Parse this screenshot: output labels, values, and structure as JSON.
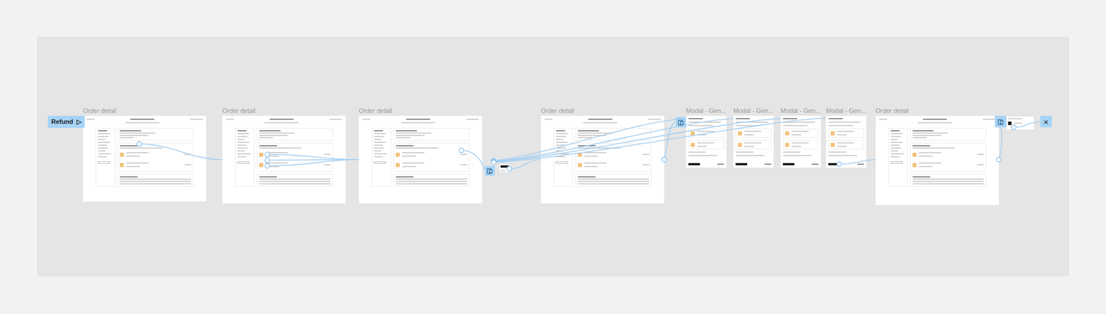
{
  "flow_start": {
    "label": "Refund",
    "icon": "▷"
  },
  "frames": [
    {
      "label": "Order detail",
      "kind": "page"
    },
    {
      "label": "Order detail",
      "kind": "page"
    },
    {
      "label": "Order detail",
      "kind": "page"
    },
    {
      "label": "Order detail",
      "kind": "page"
    },
    {
      "label": "Modal - Gen...",
      "kind": "modal"
    },
    {
      "label": "Modal - Gen...",
      "kind": "modal"
    },
    {
      "label": "Modal - Gen...",
      "kind": "modal"
    },
    {
      "label": "Modal - Gen...",
      "kind": "modal"
    },
    {
      "label": "Order detail",
      "kind": "page"
    }
  ],
  "close": {
    "icon": "×"
  }
}
